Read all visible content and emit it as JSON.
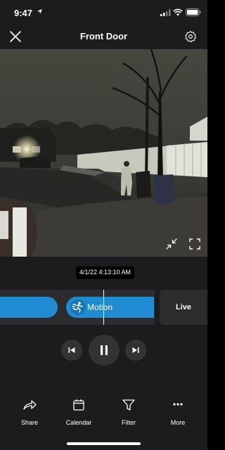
{
  "status_bar": {
    "time": "9:47"
  },
  "header": {
    "title": "Front Door"
  },
  "video": {
    "timestamp": "4/1/22 4:13:10 AM"
  },
  "timeline": {
    "events": [
      {
        "label": "Motion"
      }
    ],
    "live_label": "Live"
  },
  "nav": {
    "items": [
      {
        "label": "Share",
        "icon": "share-icon"
      },
      {
        "label": "Calendar",
        "icon": "calendar-icon"
      },
      {
        "label": "Filter",
        "icon": "filter-icon"
      },
      {
        "label": "More",
        "icon": "more-icon"
      }
    ]
  },
  "colors": {
    "accent": "#1e8bd2",
    "background": "#1c1c1e",
    "control_bg": "#333336"
  }
}
